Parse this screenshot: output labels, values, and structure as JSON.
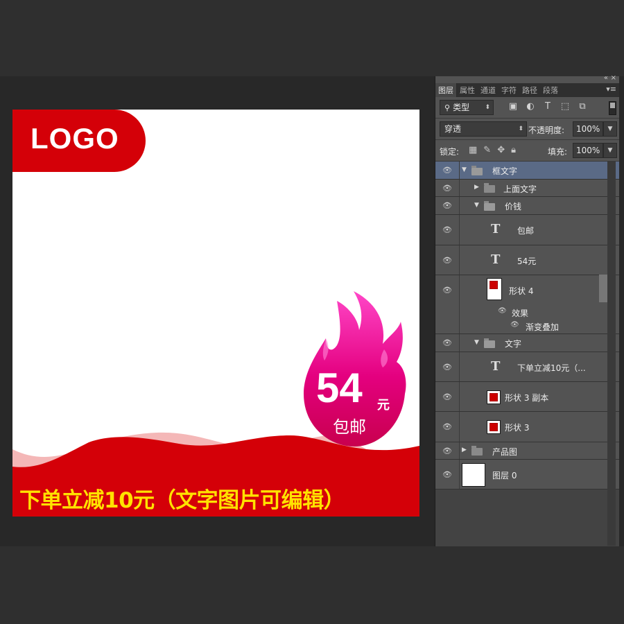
{
  "canvas": {
    "logo_text": "LOGO",
    "price_number": "54",
    "price_unit": "元",
    "price_subtitle": "包邮",
    "promo_text": "下单立减10元（文字图片可编辑）",
    "colors": {
      "red": "#d40008",
      "pink_light": "#f4b7b7",
      "magenta": "#e4007f",
      "yellow": "#ffe200"
    }
  },
  "panel": {
    "tabs": [
      "图层",
      "属性",
      "通道",
      "字符",
      "路径",
      "段落"
    ],
    "filter_label": "类型",
    "blend_mode": "穿透",
    "opacity_label": "不透明度:",
    "opacity_value": "100%",
    "lock_label": "锁定:",
    "fill_label": "填充:",
    "fill_value": "100%"
  },
  "layers": [
    {
      "name": "框文字",
      "kind": "group-open",
      "indent": 0,
      "selected": true
    },
    {
      "name": "上面文字",
      "kind": "group-closed",
      "indent": 1
    },
    {
      "name": "价钱",
      "kind": "group-open",
      "indent": 1
    },
    {
      "name": "包邮",
      "kind": "text",
      "indent": 2
    },
    {
      "name": "54元",
      "kind": "text",
      "indent": 2
    },
    {
      "name": "形状 4",
      "kind": "shape-fx",
      "indent": 2,
      "effects_label": "效果",
      "effect_item": "渐变叠加"
    },
    {
      "name": "文字",
      "kind": "group-open",
      "indent": 1
    },
    {
      "name": "下单立减10元（...",
      "kind": "text",
      "indent": 2
    },
    {
      "name": "形状 3 副本",
      "kind": "shape",
      "indent": 2
    },
    {
      "name": "形状 3",
      "kind": "shape",
      "indent": 2
    },
    {
      "name": "产品图",
      "kind": "group-closed",
      "indent": 0
    },
    {
      "name": "图层 0",
      "kind": "pixel",
      "indent": 0
    }
  ]
}
